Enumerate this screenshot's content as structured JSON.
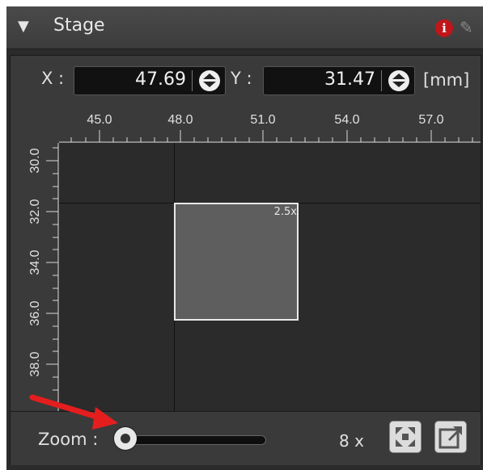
{
  "panel": {
    "title": "Stage",
    "collapse_glyph": "▼",
    "info_glyph": "i",
    "pin_glyph": "✎"
  },
  "coords": {
    "x_label": "X :",
    "x_value": "47.69",
    "y_label": "Y :",
    "y_value": "31.47",
    "unit": "[mm]"
  },
  "ruler": {
    "x_ticks": [
      "45.0",
      "48.0",
      "51.0",
      "54.0",
      "57.0"
    ],
    "y_ticks": [
      "30.0",
      "32.0",
      "34.0",
      "36.0",
      "38.0"
    ]
  },
  "stage": {
    "fov_label": "2.5x"
  },
  "zoom": {
    "label": "Zoom :",
    "value": "8 x",
    "slider_level": 0.05
  },
  "buttons": {
    "fit_icon": "fit-to-view-icon",
    "popout_icon": "pop-out-icon"
  },
  "colors": {
    "panel_bg": "#2b2b2b",
    "fov_fill": "#5e5e5e",
    "info_red": "#c0161a",
    "annotation_arrow": "#e41e1e"
  }
}
